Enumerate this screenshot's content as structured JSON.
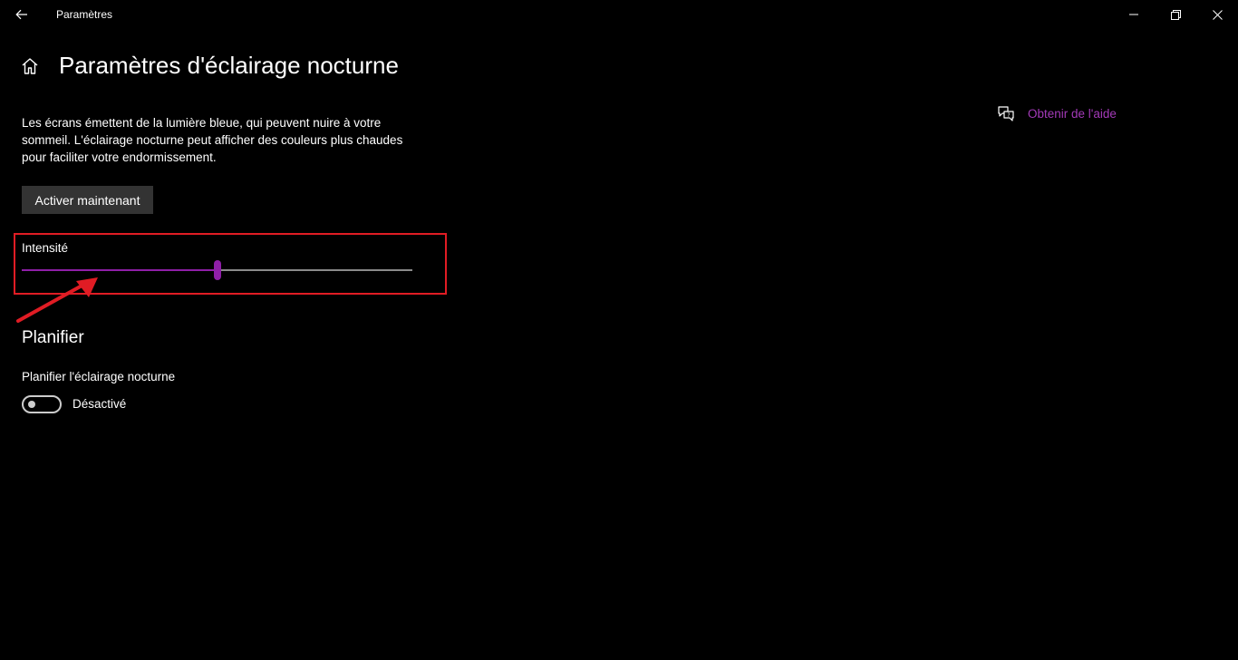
{
  "window": {
    "title": "Paramètres",
    "icons": {
      "back": "back-arrow-icon",
      "minimize": "minimize-icon",
      "maximize": "restore-icon",
      "close": "close-icon"
    }
  },
  "page": {
    "title": "Paramètres d'éclairage nocturne",
    "home_icon": "home-icon",
    "description": "Les écrans émettent de la lumière bleue, qui peuvent nuire à votre sommeil. L'éclairage nocturne peut afficher des couleurs plus chaudes pour faciliter votre endormissement.",
    "activate_button": "Activer maintenant"
  },
  "intensity": {
    "label": "Intensité",
    "value": 0.5,
    "accent_color": "#8f1fa8",
    "track_color": "#8a8a8a"
  },
  "annotation": {
    "highlight_color": "#e01c24"
  },
  "schedule": {
    "section_title": "Planifier",
    "label": "Planifier l'éclairage nocturne",
    "toggle_state": "Désactivé",
    "toggle_on": false
  },
  "help": {
    "label": "Obtenir de l'aide",
    "icon": "help-chat-icon",
    "color": "#a33ab8"
  }
}
